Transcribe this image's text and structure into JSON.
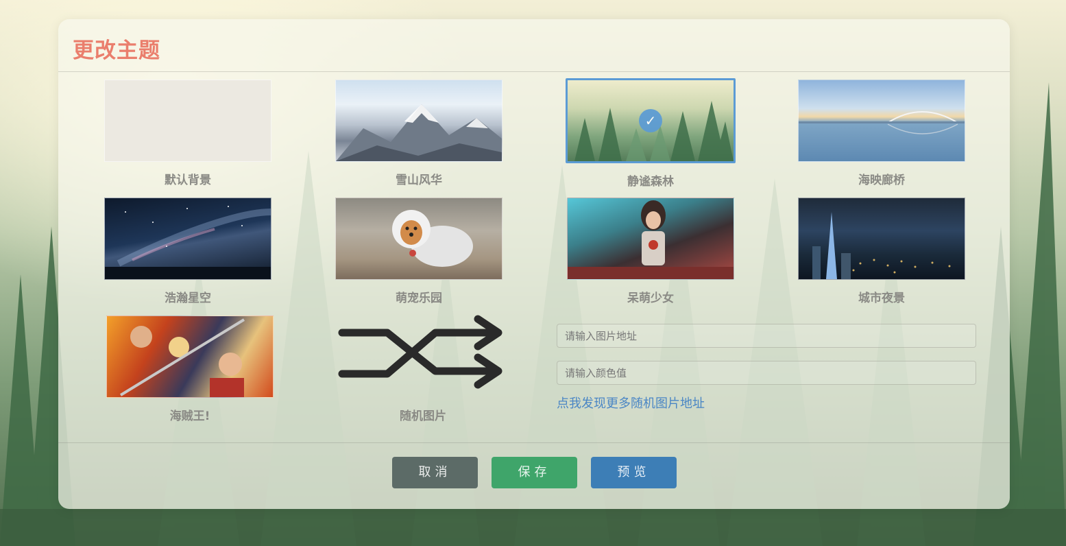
{
  "dialog": {
    "title": "更改主题"
  },
  "themes": [
    {
      "label": "默认背景",
      "selected": false
    },
    {
      "label": "雪山风华",
      "selected": false
    },
    {
      "label": "静谧森林",
      "selected": true
    },
    {
      "label": "海映廊桥",
      "selected": false
    },
    {
      "label": "浩瀚星空",
      "selected": false
    },
    {
      "label": "萌宠乐园",
      "selected": false
    },
    {
      "label": "呆萌少女",
      "selected": false
    },
    {
      "label": "城市夜景",
      "selected": false
    },
    {
      "label": "海贼王!",
      "selected": false
    }
  ],
  "random": {
    "label": "随机图片",
    "icon": "shuffle-icon"
  },
  "custom": {
    "image_url_placeholder": "请输入图片地址",
    "color_placeholder": "请输入颜色值",
    "more_link": "点我发现更多随机图片地址"
  },
  "buttons": {
    "cancel": "取消",
    "save": "保存",
    "preview": "预览"
  },
  "colors": {
    "title": "#ea7e6c",
    "selected_border": "#5b9bd5",
    "cancel": "#5c6b67",
    "save": "#3fa56a",
    "preview": "#3d7eb6",
    "link": "#4a86c5"
  }
}
